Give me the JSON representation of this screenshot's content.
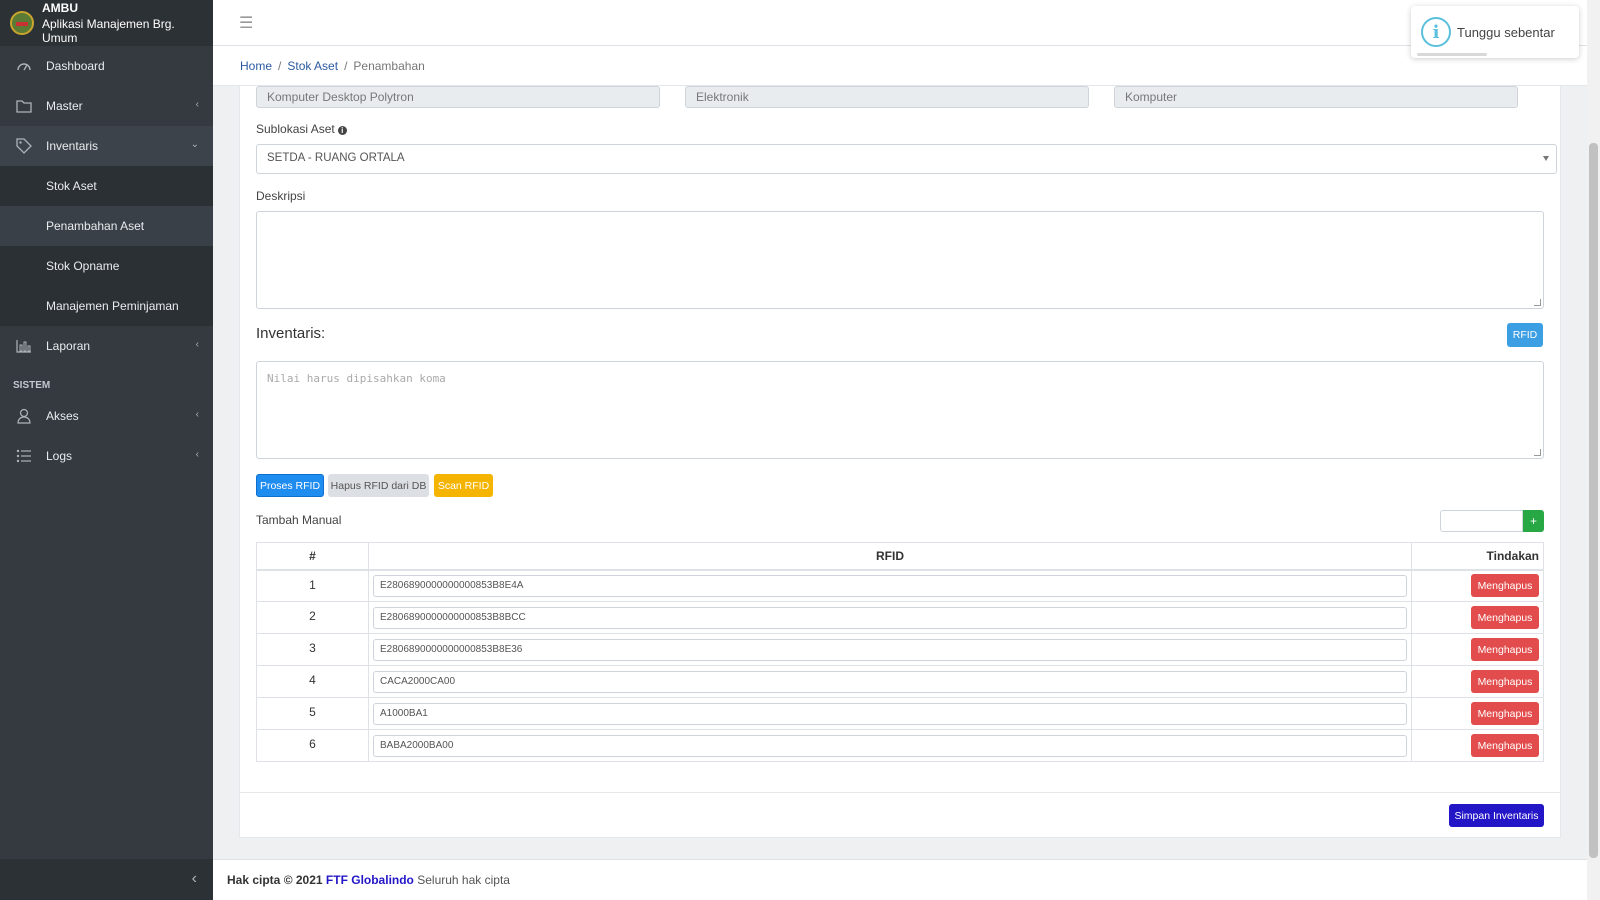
{
  "brand": {
    "name": "AMBU",
    "subtitle": "Aplikasi Manajemen Brg. Umum"
  },
  "sidebar": {
    "items": [
      {
        "label": "Dashboard",
        "icon": "palette-icon"
      },
      {
        "label": "Master",
        "icon": "folder-icon"
      },
      {
        "label": "Inventaris",
        "icon": "tag-icon"
      }
    ],
    "sub_items": [
      {
        "label": "Stok Aset"
      },
      {
        "label": "Penambahan Aset"
      },
      {
        "label": "Stok Opname"
      },
      {
        "label": "Manajemen Peminjaman"
      }
    ],
    "laporan": {
      "label": "Laporan",
      "icon": "bar-chart-icon"
    },
    "section_header": "SISTEM",
    "system_items": [
      {
        "label": "Akses",
        "icon": "user-icon"
      },
      {
        "label": "Logs",
        "icon": "list-icon"
      }
    ]
  },
  "breadcrumb": {
    "home": "Home",
    "stok": "Stok Aset",
    "current": "Penambahan"
  },
  "toast": {
    "message": "Tunggu sebentar"
  },
  "form": {
    "top_fields": [
      "Komputer Desktop Polytron",
      "Elektronik",
      "Komputer"
    ],
    "sublokasi_label": "Sublokasi Aset",
    "sublokasi_value": "SETDA - RUANG ORTALA",
    "deskripsi_label": "Deskripsi",
    "inventaris_title": "Inventaris:",
    "rfid_button": "RFID",
    "inventaris_placeholder": "Nilai harus dipisahkan koma",
    "buttons": {
      "proses": "Proses RFID",
      "hapus": "Hapus RFID dari DB",
      "scan": "Scan RFID"
    },
    "tambah_manual": "Tambah Manual",
    "add_button": "+"
  },
  "table": {
    "headers": [
      "#",
      "RFID",
      "Tindakan"
    ],
    "delete_label": "Menghapus",
    "rows": [
      {
        "num": "1",
        "rfid": "E2806890000000000853B8E4A"
      },
      {
        "num": "2",
        "rfid": "E2806890000000000853B8BCC"
      },
      {
        "num": "3",
        "rfid": "E2806890000000000853B8E36"
      },
      {
        "num": "4",
        "rfid": "CACA2000CA00"
      },
      {
        "num": "5",
        "rfid": "A1000BA1"
      },
      {
        "num": "6",
        "rfid": "BABA2000BA00"
      }
    ]
  },
  "save_button": "Simpan Inventaris",
  "footer": {
    "copyright": "Hak cipta © 2021",
    "company": "FTF Globalindo",
    "rights": "Seluruh hak cipta"
  }
}
